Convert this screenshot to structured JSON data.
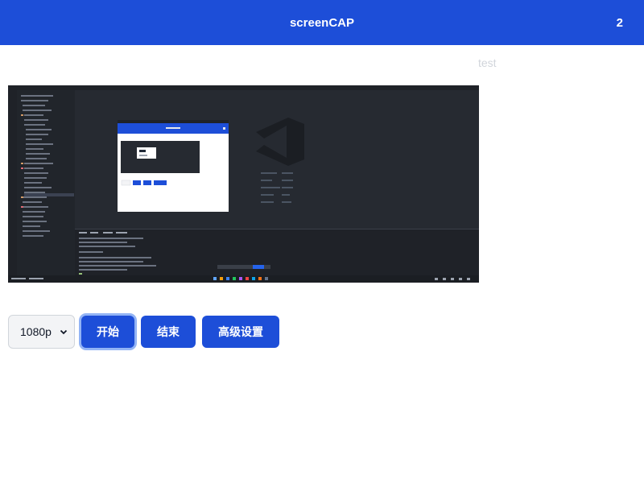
{
  "header": {
    "title": "screenCAP",
    "count": "2"
  },
  "main": {
    "test_label": "test",
    "preview_image": "screen-capture-preview",
    "controls": {
      "resolution": {
        "selected": "1080p"
      },
      "start_label": "开始",
      "stop_label": "结束",
      "settings_label": "高级设置"
    }
  },
  "colors": {
    "brand": "#1d4ed8",
    "muted_text": "#d1d5db",
    "preview_bg": "#262a31"
  }
}
